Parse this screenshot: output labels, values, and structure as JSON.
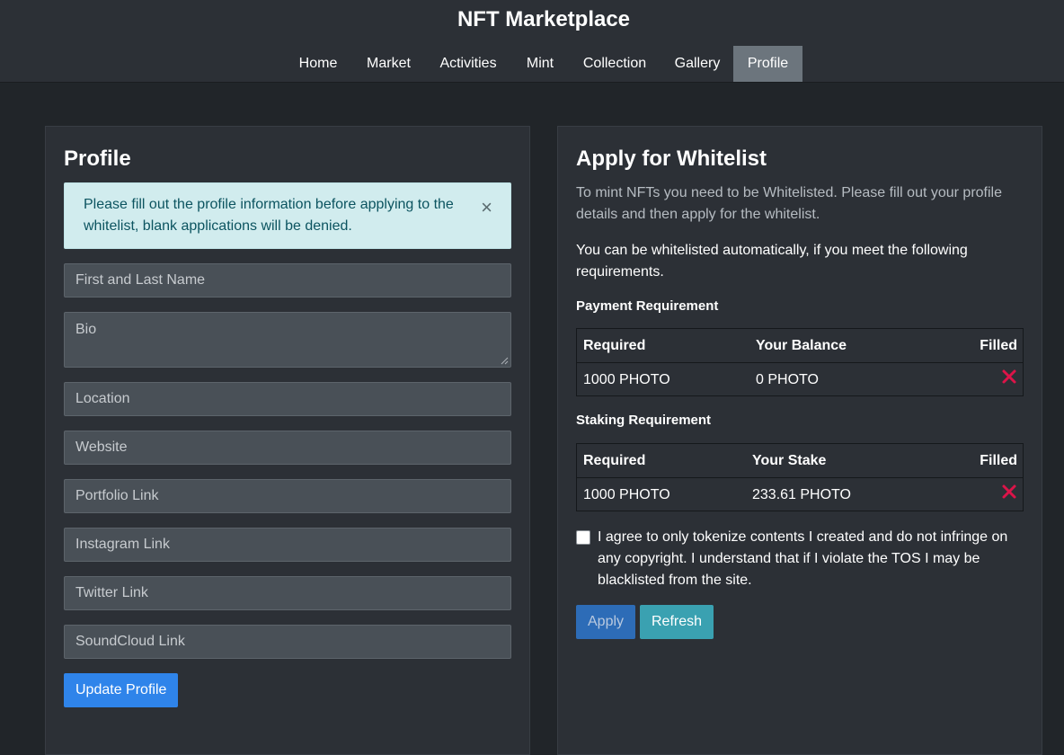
{
  "header": {
    "title": "NFT Marketplace",
    "nav": [
      "Home",
      "Market",
      "Activities",
      "Mint",
      "Collection",
      "Gallery",
      "Profile"
    ],
    "active": "Profile"
  },
  "profile": {
    "title": "Profile",
    "alert": "Please fill out the profile information before applying to the whitelist, blank applications will be denied.",
    "alert_close": "×",
    "placeholders": {
      "name": "First and Last Name",
      "bio": "Bio",
      "location": "Location",
      "website": "Website",
      "portfolio": "Portfolio Link",
      "instagram": "Instagram Link",
      "twitter": "Twitter Link",
      "soundcloud": "SoundCloud Link"
    },
    "update_button": "Update Profile"
  },
  "whitelist": {
    "title": "Apply for Whitelist",
    "intro": "To mint NFTs you need to be Whitelisted. Please fill out your profile details and then apply for the whitelist.",
    "auto": "You can be whitelisted automatically, if you meet the following requirements.",
    "payment": {
      "heading": "Payment Requirement",
      "columns": [
        "Required",
        "Your Balance",
        "Filled"
      ],
      "row": {
        "required": "1000 PHOTO",
        "current": "0 PHOTO",
        "filled": false
      }
    },
    "staking": {
      "heading": "Staking Requirement",
      "columns": [
        "Required",
        "Your Stake",
        "Filled"
      ],
      "row": {
        "required": "1000 PHOTO",
        "current": "233.61 PHOTO",
        "filled": false
      }
    },
    "agree_text": "I agree to only tokenize contents I created and do not infringe on any copyright. I understand that if I violate the TOS I may be blacklisted from the site.",
    "agree_checked": false,
    "apply_button": "Apply",
    "refresh_button": "Refresh"
  },
  "colors": {
    "background": "#212529",
    "panel": "#2c3036",
    "active_nav": "#6c757d",
    "primary": "#2f84ea",
    "info": "#3aa1b1",
    "danger": "#dc1449",
    "alert_bg": "#d1ecee"
  }
}
